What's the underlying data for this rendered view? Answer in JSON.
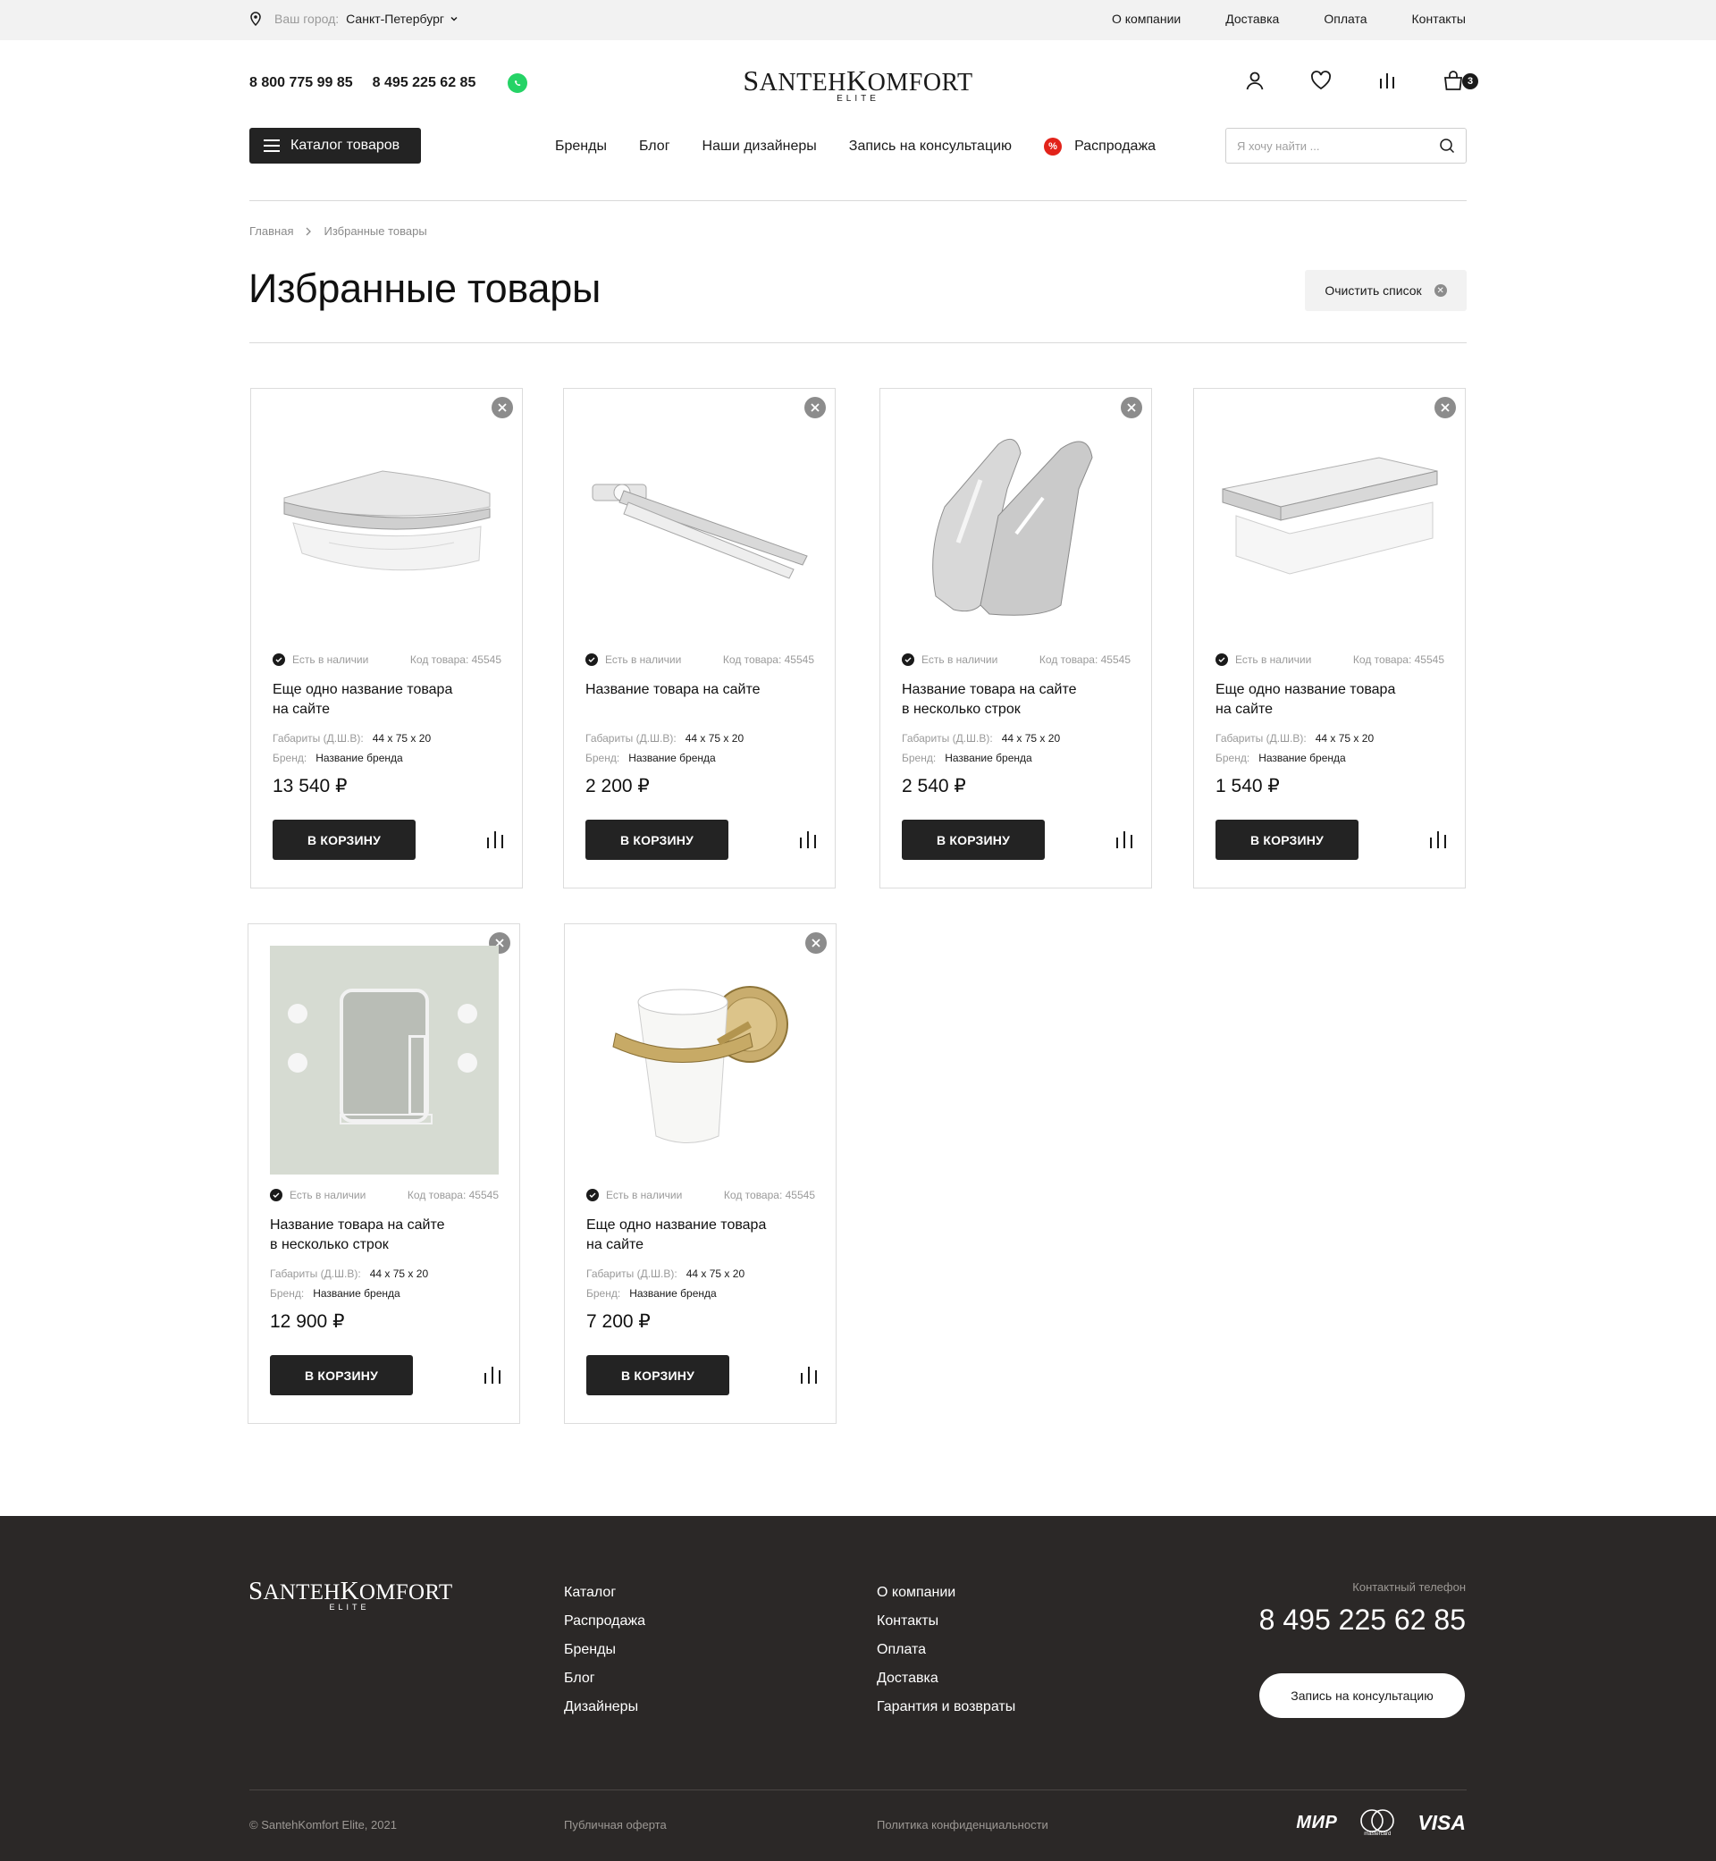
{
  "topbar": {
    "city_label": "Ваш город:",
    "city_value": "Санкт-Петербург",
    "links": [
      "О компании",
      "Доставка",
      "Оплата",
      "Контакты"
    ]
  },
  "header": {
    "phones": [
      "8 800 775 99 85",
      "8 495 225 62 85"
    ],
    "logo_main_1": "S",
    "logo_main_2": "ANTEH",
    "logo_main_3": "K",
    "logo_main_4": "OMFORT",
    "logo_sub": "ELITE",
    "cart_count": "3"
  },
  "nav": {
    "catalog_label": "Каталог товаров",
    "items": [
      "Бренды",
      "Блог",
      "Наши дизайнеры",
      "Запись на консультацию",
      "Распродажа"
    ],
    "sale_badge": "%",
    "search_placeholder": "Я хочу найти ..."
  },
  "breadcrumb": [
    "Главная",
    "Избранные товары"
  ],
  "page": {
    "title": "Избранные товары",
    "clear_label": "Очистить список"
  },
  "card_labels": {
    "in_stock": "Есть в наличии",
    "code_prefix": "Код товара: ",
    "dims_label": "Габариты (Д.Ш.В):",
    "brand_label": "Бренд:",
    "buy_label": "В КОРЗИНУ"
  },
  "products": [
    {
      "code": "45545",
      "name1": "Еще одно название товара",
      "name2": "на сайте",
      "dims": "44 x 75 x 20",
      "brand": "Название бренда",
      "price": "13 540 ₽",
      "image": "corner-shelf"
    },
    {
      "code": "45545",
      "name1": "Название товара на сайте",
      "name2": "",
      "dims": "44 x 75 x 20",
      "brand": "Название бренда",
      "price": "2 200 ₽",
      "image": "towel-holder"
    },
    {
      "code": "45545",
      "name1": "Название товара на сайте",
      "name2": "в несколько строк",
      "dims": "44 x 75 x 20",
      "brand": "Название бренда",
      "price": "2 540 ₽",
      "image": "double-hook"
    },
    {
      "code": "45545",
      "name1": "Еще одно название товара",
      "name2": "на сайте",
      "dims": "44 x 75 x 20",
      "brand": "Название бренда",
      "price": "1 540 ₽",
      "image": "rect-shelf"
    },
    {
      "code": "45545",
      "name1": "Название товара на сайте",
      "name2": "в несколько строк",
      "dims": "44 x 75 x 20",
      "brand": "Название бренда",
      "price": "12 900 ₽",
      "image": "mirror-set"
    },
    {
      "code": "45545",
      "name1": "Еще одно название товара",
      "name2": "на сайте",
      "dims": "44 x 75 x 20",
      "brand": "Название бренда",
      "price": "7 200 ₽",
      "image": "glass-holder"
    }
  ],
  "footer": {
    "col1": [
      "Каталог",
      "Распродажа",
      "Бренды",
      "Блог",
      "Дизайнеры"
    ],
    "col2": [
      "О компании",
      "Контакты",
      "Оплата",
      "Доставка",
      "Гарантия и возвраты"
    ],
    "contact_label": "Контактный телефон",
    "contact_phone": "8 495 225 62 85",
    "consult_label": "Запись на консультацию",
    "copyright": "© SantehKomfort Elite, 2021",
    "offer": "Публичная оферта",
    "privacy": "Политика конфиденциальности",
    "pay_mir": "МИР",
    "pay_mastercard_caption": "mastercard",
    "pay_visa": "VISA"
  },
  "colors": {
    "accent_dark": "#232323",
    "footer_bg": "#2b2827",
    "sale_red": "#e2231a",
    "whatsapp_green": "#25d366"
  }
}
